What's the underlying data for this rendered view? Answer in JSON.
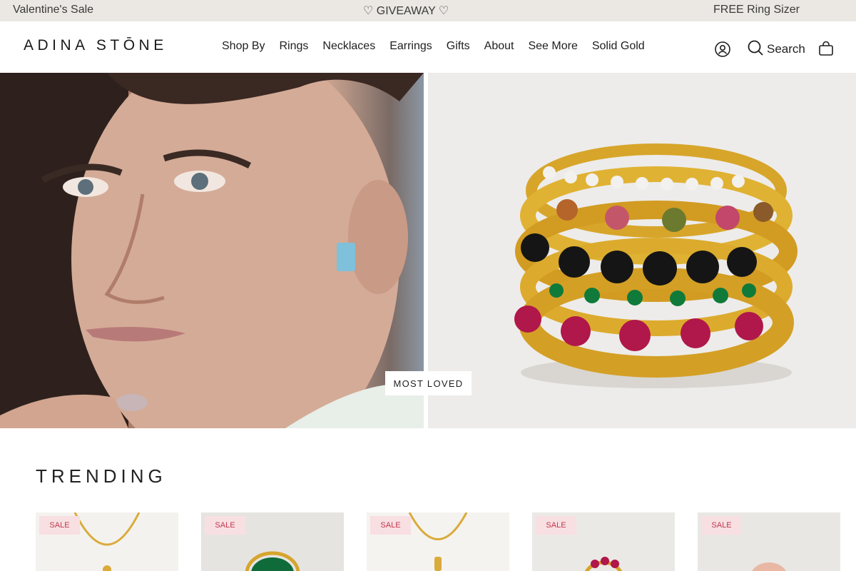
{
  "announcement": {
    "left": "Valentine's Sale",
    "center": "♡ GIVEAWAY ♡",
    "right": "FREE Ring Sizer"
  },
  "brand": {
    "logo": "ADINA STŌNE"
  },
  "nav": {
    "items": [
      "Shop By",
      "Rings",
      "Necklaces",
      "Earrings",
      "Gifts",
      "About",
      "See More",
      "Solid Gold"
    ]
  },
  "header_actions": {
    "account_icon": "account-icon",
    "search_icon": "search-icon",
    "search_label": "Search",
    "cart_icon": "bag-icon"
  },
  "hero": {
    "button_label": "MOST LOVED",
    "left_image": "woman-wearing-aquamarine-earring",
    "right_image": "stack-of-gold-gemstone-rings"
  },
  "trending": {
    "title": "TRENDING",
    "products": [
      {
        "badge": "SALE",
        "image": "gold-pendant-necklace"
      },
      {
        "badge": "SALE",
        "image": "green-stone-gold-ring"
      },
      {
        "badge": "SALE",
        "image": "gold-chain-pendant"
      },
      {
        "badge": "SALE",
        "image": "ruby-bezel-ring"
      },
      {
        "badge": "SALE",
        "image": "rose-gem-ring"
      }
    ]
  },
  "colors": {
    "announcement_bg": "#ebe8e3",
    "sale_badge_bg": "#f8dfe2",
    "sale_badge_text": "#c0394d"
  }
}
